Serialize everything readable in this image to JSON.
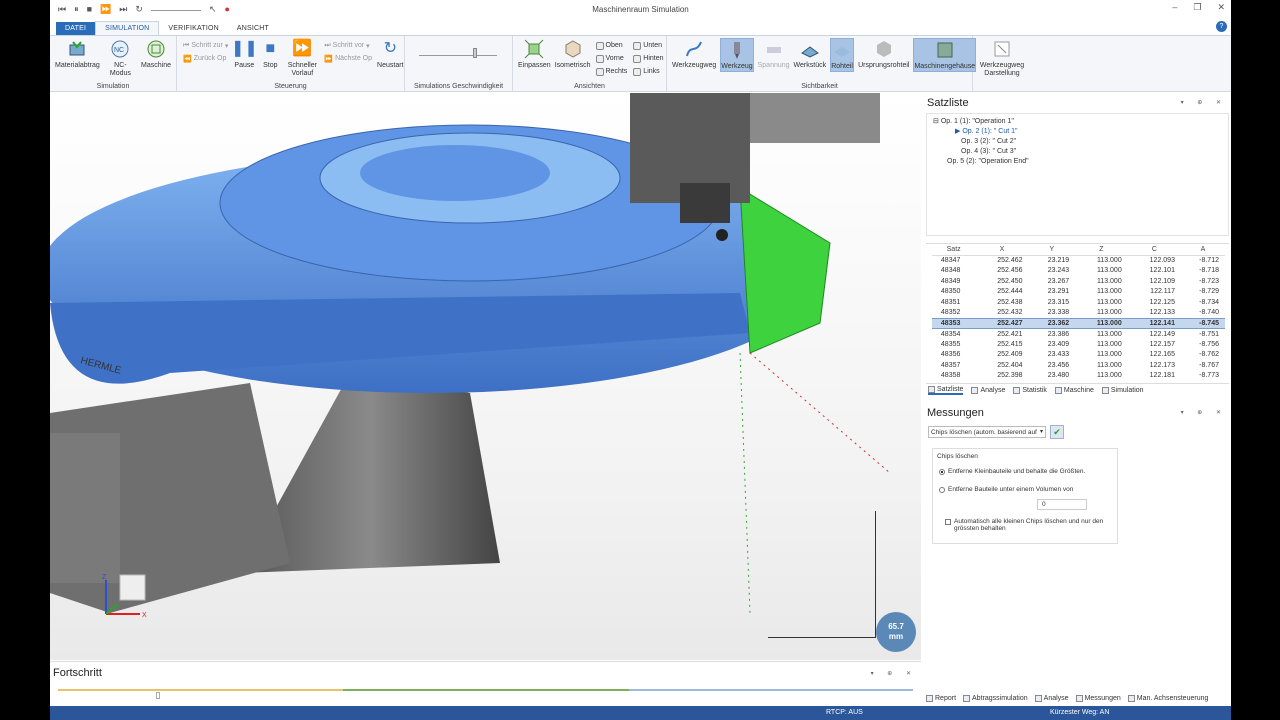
{
  "window": {
    "title": "Maschinenraum Simulation"
  },
  "ribbon_tabs": [
    "DATEI",
    "SIMULATION",
    "VERIFIKATION",
    "ANSICHT"
  ],
  "groups": {
    "simulation": {
      "label": "Simulation",
      "buttons": [
        "Materialabtrag",
        "NC-Modus",
        "Maschine"
      ]
    },
    "steuerung": {
      "label": "Steuerung",
      "schritt_zur": "Schritt zur",
      "zurueck_op": "Zurück Op",
      "pause": "Pause",
      "stop": "Stop",
      "schneller": "Schneller Vorlauf",
      "schritt_vor": "Schritt vor",
      "naechste_op": "Nächste Op",
      "neustart": "Neustart"
    },
    "speed": {
      "label": "Simulations Geschwindigkeit"
    },
    "ansichten": {
      "label": "Ansichten",
      "einpassen": "Einpassen",
      "isometrisch": "Isometrisch",
      "oben": "Oben",
      "vorne": "Vorne",
      "rechts": "Rechts",
      "unten": "Unten",
      "hinten": "Hinten",
      "links": "Links"
    },
    "sichtbarkeit": {
      "label": "Sichtbarkeit",
      "items": [
        "Werkzeugweg",
        "Werkzeug",
        "Spannung",
        "Werkstück",
        "Rohteil",
        "Ursprungsrohteil",
        "Maschinengehäuse"
      ]
    },
    "darstellung": {
      "label": "Werkzeugweg Darstellung"
    }
  },
  "satzliste": {
    "title": "Satzliste",
    "tree": [
      {
        "label": "Op. 1 (1): \"Operation 1\""
      },
      {
        "label": "Op. 2 (1): \" Cut 1\""
      },
      {
        "label": "Op. 3 (2): \" Cut 2\""
      },
      {
        "label": "Op. 4 (3): \" Cut 3\""
      },
      {
        "label": "Op. 5 (2): \"Operation End\""
      }
    ],
    "columns": [
      "Satz",
      "X",
      "Y",
      "Z",
      "C",
      "A"
    ],
    "rows": [
      [
        "48347",
        "252.462",
        "23.219",
        "113.000",
        "122.093",
        "-8.712"
      ],
      [
        "48348",
        "252.456",
        "23.243",
        "113.000",
        "122.101",
        "-8.718"
      ],
      [
        "48349",
        "252.450",
        "23.267",
        "113.000",
        "122.109",
        "-8.723"
      ],
      [
        "48350",
        "252.444",
        "23.291",
        "113.000",
        "122.117",
        "-8.729"
      ],
      [
        "48351",
        "252.438",
        "23.315",
        "113.000",
        "122.125",
        "-8.734"
      ],
      [
        "48352",
        "252.432",
        "23.338",
        "113.000",
        "122.133",
        "-8.740"
      ],
      [
        "48353",
        "252.427",
        "23.362",
        "113.000",
        "122.141",
        "-8.745"
      ],
      [
        "48354",
        "252.421",
        "23.386",
        "113.000",
        "122.149",
        "-8.751"
      ],
      [
        "48355",
        "252.415",
        "23.409",
        "113.000",
        "122.157",
        "-8.756"
      ],
      [
        "48356",
        "252.409",
        "23.433",
        "113.000",
        "122.165",
        "-8.762"
      ],
      [
        "48357",
        "252.404",
        "23.456",
        "113.000",
        "122.173",
        "-8.767"
      ],
      [
        "48358",
        "252.398",
        "23.480",
        "113.000",
        "122.181",
        "-8.773"
      ]
    ],
    "current_row": 6,
    "tabs": [
      "Satzliste",
      "Analyse",
      "Statistik",
      "Maschine",
      "Simulation"
    ]
  },
  "messungen": {
    "title": "Messungen",
    "select_value": "Chips löschen (autom. basierend auf",
    "group_title": "Chips löschen",
    "radio1": "Entferne Kleinbauteile und behalte die Größten.",
    "radio2": "Entferne Bauteile unter einem Volumen von",
    "volume": "0",
    "auto_label": "Automatisch alle kleinen Chips löschen und nur den grössten behalten"
  },
  "bottom_tabs": [
    "Report",
    "Abtragssimulation",
    "Analyse",
    "Messungen",
    "Man. Achsensteuerung"
  ],
  "fortschritt": {
    "title": "Fortschritt"
  },
  "viewport": {
    "distance": "65.7",
    "distance_unit": "mm",
    "brand": "HERMLE",
    "axis_x": "X",
    "axis_z": "Z"
  },
  "status": {
    "rtcp": "RTCP: AUS",
    "weg": "Kürzester Weg: AN"
  },
  "colors": {
    "accent": "#2b6cb8",
    "part": "#5b8fe0",
    "removed": "#33dd33"
  }
}
